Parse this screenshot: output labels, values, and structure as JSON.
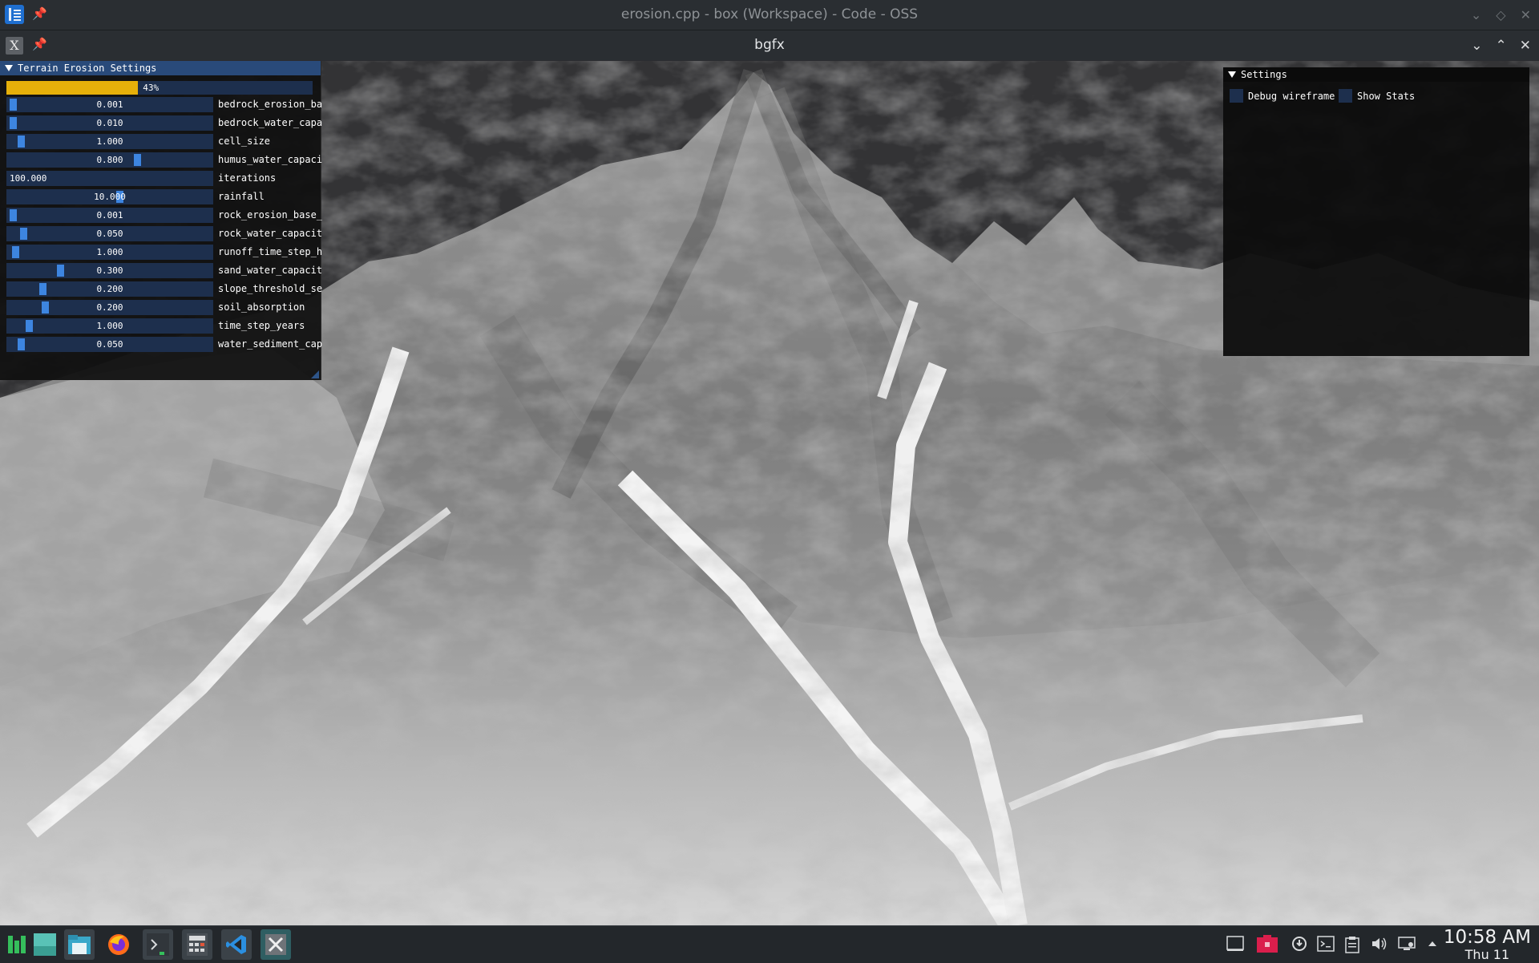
{
  "outer_window": {
    "title": "erosion.cpp - box (Workspace) - Code - OSS",
    "buttons": [
      "chevron-down",
      "restore",
      "close"
    ]
  },
  "inner_window": {
    "title": "bgfx",
    "buttons": [
      "chevron-down",
      "chevron-up",
      "close"
    ]
  },
  "terrain_panel": {
    "title": "Terrain Erosion Settings",
    "progress": {
      "fraction": 0.43,
      "label": "43%"
    },
    "sliders": [
      {
        "label": "bedrock_erosion_ba",
        "value": "0.001",
        "fraction": 0.01
      },
      {
        "label": "bedrock_water_capa",
        "value": "0.010",
        "fraction": 0.01
      },
      {
        "label": "cell_size",
        "value": "1.000",
        "fraction": 0.05
      },
      {
        "label": "humus_water_capaci",
        "value": "0.800",
        "fraction": 0.64
      },
      {
        "label": "iterations",
        "value": "100.000",
        "fraction": null
      },
      {
        "label": "rainfall",
        "value": "10.000",
        "fraction": 0.55
      },
      {
        "label": "rock_erosion_base_",
        "value": "0.001",
        "fraction": 0.01
      },
      {
        "label": "rock_water_capacit",
        "value": "0.050",
        "fraction": 0.06
      },
      {
        "label": "runoff_time_step_h",
        "value": "1.000",
        "fraction": 0.02
      },
      {
        "label": "sand_water_capacit",
        "value": "0.300",
        "fraction": 0.25
      },
      {
        "label": "slope_threshold_se",
        "value": "0.200",
        "fraction": 0.16
      },
      {
        "label": "soil_absorption",
        "value": "0.200",
        "fraction": 0.17
      },
      {
        "label": "time_step_years",
        "value": "1.000",
        "fraction": 0.09
      },
      {
        "label": "water_sediment_cap",
        "value": "0.050",
        "fraction": 0.05
      }
    ]
  },
  "settings_panel": {
    "title": "Settings",
    "checkboxes": [
      {
        "label": "Debug wireframe",
        "checked": false
      },
      {
        "label": "Show Stats",
        "checked": false
      }
    ]
  },
  "taskbar": {
    "apps": [
      "app-launcher",
      "desktop",
      "file-manager",
      "firefox",
      "terminal",
      "calculator",
      "vscode",
      "bgfx-app"
    ],
    "tray": [
      "screen-icon",
      "vault-icon",
      "update-icon",
      "terminal-icon",
      "clipboard-icon",
      "volume-icon",
      "network-icon",
      "expand-icon"
    ],
    "clock": {
      "time": "10:58 AM",
      "date": "Thu 11"
    }
  }
}
